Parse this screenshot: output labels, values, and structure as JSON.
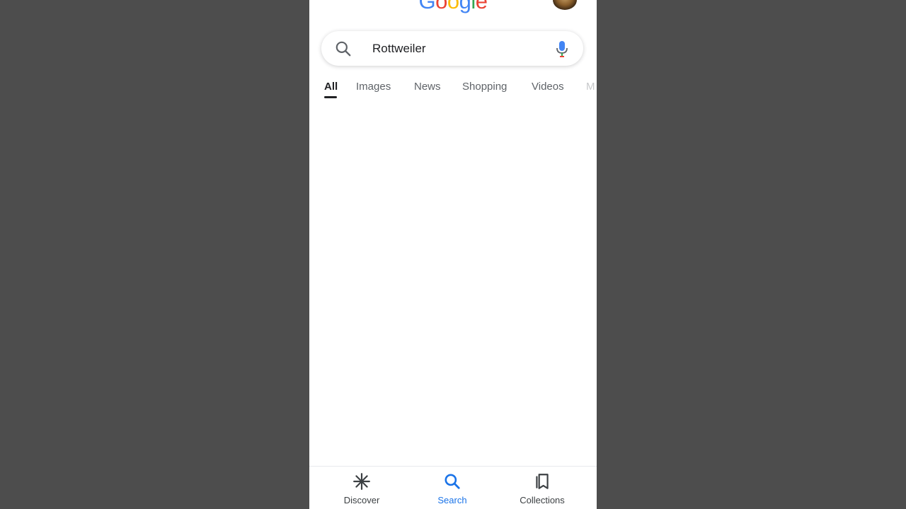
{
  "app": {
    "logo_letters": [
      "G",
      "o",
      "o",
      "g",
      "l",
      "e"
    ],
    "logo_colors": [
      "#4285F4",
      "#EA4335",
      "#FBBC05",
      "#4285F4",
      "#34A853",
      "#EA4335"
    ]
  },
  "search": {
    "query": "Rottweiler",
    "icon": "search-icon",
    "voice_icon": "mic-icon"
  },
  "tabs": [
    {
      "label": "All",
      "active": true
    },
    {
      "label": "Images",
      "active": false
    },
    {
      "label": "News",
      "active": false
    },
    {
      "label": "Shopping",
      "active": false
    },
    {
      "label": "Videos",
      "active": false
    },
    {
      "label": "M",
      "active": false
    }
  ],
  "bottom_nav": [
    {
      "label": "Discover",
      "icon": "discover-asterisk-icon",
      "active": false
    },
    {
      "label": "Search",
      "icon": "search-icon",
      "active": true
    },
    {
      "label": "Collections",
      "icon": "collections-icon",
      "active": false
    }
  ],
  "colors": {
    "accent": "#1a73e8",
    "background_outer": "#4d4d4d",
    "page_background": "#ffffff"
  }
}
